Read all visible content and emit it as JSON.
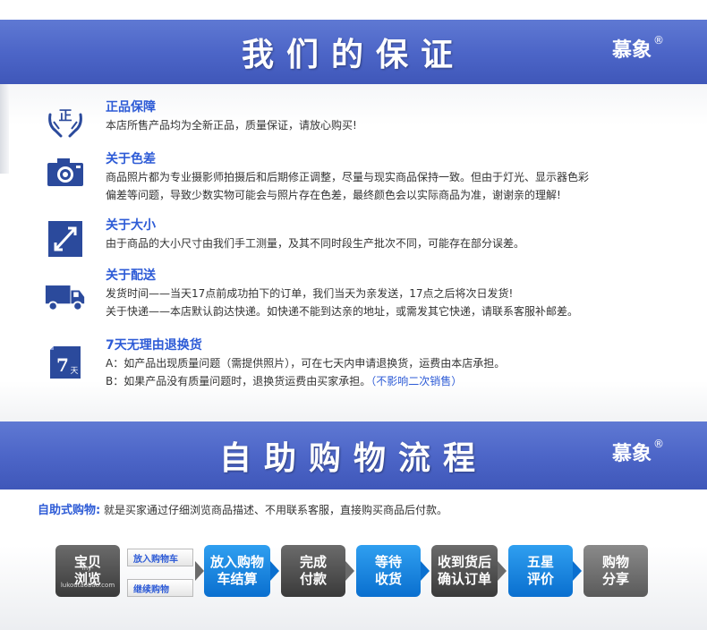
{
  "guarantee": {
    "title": "我们的保证",
    "brand": "慕象",
    "brand_mark": "R",
    "items": [
      {
        "title": "正品保障",
        "lines": [
          "本店所售产品均为全新正品，质量保证，请放心购买!"
        ]
      },
      {
        "title": "关于色差",
        "lines": [
          "商品照片都为专业摄影师拍摄后和后期修正调整，尽量与现实商品保持一致。但由于灯光、显示器色彩",
          "偏差等问题，导致少数实物可能会与照片存在色差，最终颜色会以实际商品为准，谢谢亲的理解!"
        ]
      },
      {
        "title": "关于大小",
        "lines": [
          "由于商品的大小尺寸由我们手工测量，及其不同时段生产批次不同，可能存在部分误差。"
        ]
      },
      {
        "title": "关于配送",
        "lines": [
          "发货时间——当天17点前成功拍下的订单，我们当天为亲发送，17点之后将次日发货!",
          "关于快递——本店默认韵达快递。如快递不能到达亲的地址，或需发其它快递，请联系客服补邮差。"
        ]
      },
      {
        "title": "7天无理由退换货",
        "lines": [
          "A：如产品出现质量问题（需提供照片），可在七天内申请退换货，运费由本店承担。",
          "B：如果产品没有质量问题时，退换货运费由买家承担。"
        ],
        "hint": "（不影响二次销售）"
      }
    ],
    "icons": [
      "hands-zheng-icon",
      "camera-icon",
      "resize-arrow-icon",
      "truck-icon",
      "calendar-7-icon"
    ],
    "icon_text": {
      "zheng": "正",
      "seven": "7",
      "tian": "天"
    }
  },
  "flow": {
    "title": "自助购物流程",
    "brand": "慕象",
    "brand_mark": "R",
    "intro_lead": "自助式购物:",
    "intro_text": "就是买家通过仔细浏览商品描述、不用联系客服，直接购买商品后付款。",
    "steps": [
      {
        "label_1": "宝贝",
        "label_2": "浏览",
        "sub": "my-lukoutaobao.com"
      },
      {
        "label_1": "放入购物",
        "label_2": "车结算"
      },
      {
        "label_1": "完成",
        "label_2": "付款"
      },
      {
        "label_1": "等待",
        "label_2": "收货"
      },
      {
        "label_1": "收到货后",
        "label_2": "确认订单"
      },
      {
        "label_1": "五星",
        "label_2": "评价"
      },
      {
        "label_1": "购物",
        "label_2": "分享"
      }
    ],
    "mini_buttons": [
      "放入购物车",
      "继续购物"
    ]
  },
  "colors": {
    "banner": "#4d66c8",
    "accent": "#2d5bd6",
    "step_blue": "#0a6fcf",
    "step_dark": "#3a3a3a"
  }
}
